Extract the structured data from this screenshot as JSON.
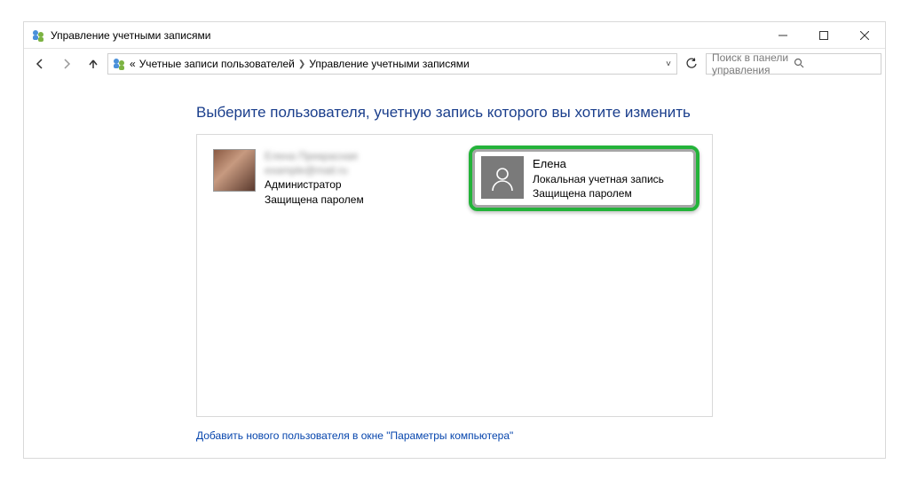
{
  "title": "Управление учетными записями",
  "breadcrumbs": {
    "prefix": "«",
    "item1": "Учетные записи пользователей",
    "item2": "Управление учетными записями"
  },
  "search": {
    "placeholder": "Поиск в панели управления"
  },
  "heading": "Выберите пользователя, учетную запись которого вы хотите изменить",
  "users": {
    "u1": {
      "name": "Елена Прекрасная",
      "email": "example@mail.ru",
      "role": "Администратор",
      "protected": "Защищена паролем"
    },
    "u2": {
      "name": "Елена",
      "type": "Локальная учетная запись",
      "protected": "Защищена паролем"
    }
  },
  "add_link": "Добавить нового пользователя в окне \"Параметры компьютера\""
}
